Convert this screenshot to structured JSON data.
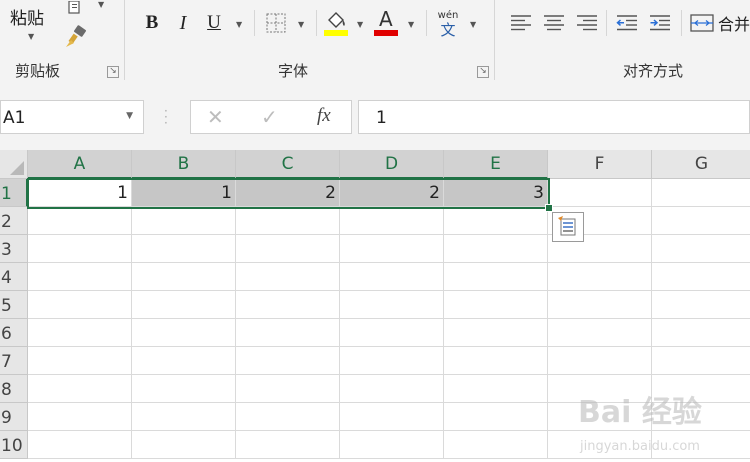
{
  "ribbon": {
    "clipboard": {
      "paste_label": "粘贴",
      "group_label": "剪贴板",
      "icons": [
        "paste-dropdown-icon",
        "copy-icon",
        "format-painter-icon"
      ]
    },
    "font": {
      "group_label": "字体",
      "bold_label": "B",
      "italic_label": "I",
      "underline_label": "U",
      "font_color_label": "A",
      "phonetic_top": "wén",
      "phonetic_bottom": "文",
      "fill_color": "#ffff00",
      "font_color": "#e00000"
    },
    "alignment": {
      "group_label": "对齐方式",
      "merge_label": "合并"
    }
  },
  "formula_bar": {
    "name_box": "A1",
    "cancel": "✕",
    "enter": "✓",
    "fx": "fx",
    "value": "1"
  },
  "grid": {
    "columns": [
      "A",
      "B",
      "C",
      "D",
      "E",
      "F",
      "G"
    ],
    "rows": [
      "1",
      "2",
      "3",
      "4",
      "5",
      "6",
      "7",
      "8",
      "9",
      "10"
    ],
    "selected_range": "A1:E1",
    "row1_values": [
      "1",
      "1",
      "2",
      "2",
      "3"
    ]
  },
  "watermark": {
    "brand": "Bai 经验",
    "url": "jingyan.baidu.com"
  },
  "colors": {
    "accent": "#217346",
    "selection_fill": "#c6c6c6"
  }
}
